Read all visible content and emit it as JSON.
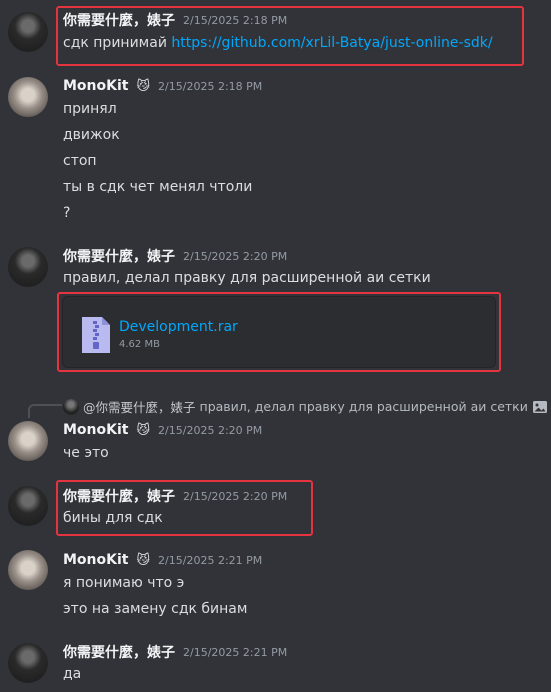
{
  "messages": [
    {
      "author": "你需要什麼，婊子",
      "timestamp": "2/15/2025 2:18 PM",
      "lines": [
        "сдк принимай"
      ],
      "link": "https://github.com/xrLil-Batya/just-online-sdk/"
    },
    {
      "author": "MonoKit",
      "badge": "😼",
      "timestamp": "2/15/2025 2:18 PM",
      "lines": [
        "принял",
        "движок",
        "стоп",
        "ты в сдк чет менял чтоли",
        "?"
      ]
    },
    {
      "author": "你需要什麼，婊子",
      "timestamp": "2/15/2025 2:20 PM",
      "lines": [
        "правил, делал правку для расширенной аи сетки"
      ],
      "attachment": {
        "name": "Development.rar",
        "size": "4.62 MB"
      }
    },
    {
      "reply": {
        "author": "@你需要什麼，婊子",
        "text": "правил, делал правку для расширенной аи сетки"
      },
      "author": "MonoKit",
      "badge": "😼",
      "timestamp": "2/15/2025 2:20 PM",
      "lines": [
        "че это"
      ]
    },
    {
      "author": "你需要什麼，婊子",
      "timestamp": "2/15/2025 2:20 PM",
      "lines": [
        "бины для сдк"
      ]
    },
    {
      "author": "MonoKit",
      "badge": "😼",
      "timestamp": "2/15/2025 2:21 PM",
      "lines": [
        "я понимаю что э",
        "это на замену сдк бинам"
      ]
    },
    {
      "author": "你需要什麼，婊子",
      "timestamp": "2/15/2025 2:21 PM",
      "lines": [
        "да"
      ]
    }
  ]
}
